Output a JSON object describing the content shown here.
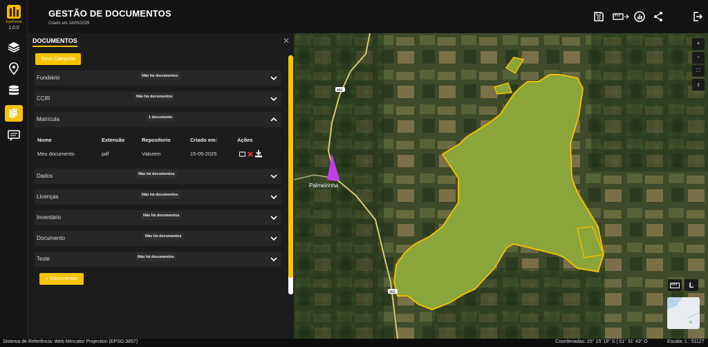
{
  "app": {
    "logo_text": "EyeForest",
    "version": "1.0.0",
    "title": "GESTÃO DE DOCUMENTOS",
    "subtitle": "Criado em 14/05/2025"
  },
  "sidebar": {
    "items": [
      {
        "name": "layers",
        "icon": "layers-icon",
        "active": false
      },
      {
        "name": "location",
        "icon": "map-pin-icon",
        "active": false
      },
      {
        "name": "database",
        "icon": "database-icon",
        "active": false
      },
      {
        "name": "documents",
        "icon": "documents-icon",
        "active": true
      },
      {
        "name": "messages",
        "icon": "message-icon",
        "active": false
      }
    ]
  },
  "header_actions": [
    "save-icon",
    "ruler-icon",
    "analytics-icon",
    "share-icon",
    "logout-icon"
  ],
  "panel": {
    "title": "DOCUMENTOS",
    "new_category_label": "Nova Categoria",
    "add_documents_label": "+ Documentos",
    "categories": [
      {
        "name": "Fundiário",
        "badge": "Não há documentos"
      },
      {
        "name": "CCIR",
        "badge": "Não há documentos"
      },
      {
        "name": "Matrícula",
        "badge": "1 documento"
      },
      {
        "name": "Dados",
        "badge": "Não há documentos"
      },
      {
        "name": "Licenças",
        "badge": "Não há documentos"
      },
      {
        "name": "Inventário",
        "badge": "Não há documentos"
      },
      {
        "name": "Documento",
        "badge": "Não há documentos"
      },
      {
        "name": "Teste",
        "badge": "Não há documentos"
      }
    ],
    "table": {
      "headers": [
        "Nome",
        "Extensão",
        "Repositorio",
        "Criado em:",
        "Ações"
      ],
      "rows": [
        {
          "nome": "Meu documento",
          "extensao": "pdf",
          "repositorio": "Valorem",
          "criado": "15-05-2025"
        }
      ]
    }
  },
  "map": {
    "place_label": "Palmeirinha",
    "road_label_1": "466",
    "road_label_2": "466",
    "controls": [
      "+",
      "−",
      "⛶",
      "⇧"
    ],
    "basemap_label": "L",
    "polygon_color": "#8aa63a",
    "polygon_border": "#f0c000",
    "marker_color": "#c040e8"
  },
  "footer": {
    "reference": "Sistema de Referência: Web Mercator Projection (EPSG:3857)",
    "coordinates": "Coordenadas: 25° 15' 18'' S | 51° 31' 43'' O",
    "scale": "Escala: 1 : 51127"
  }
}
